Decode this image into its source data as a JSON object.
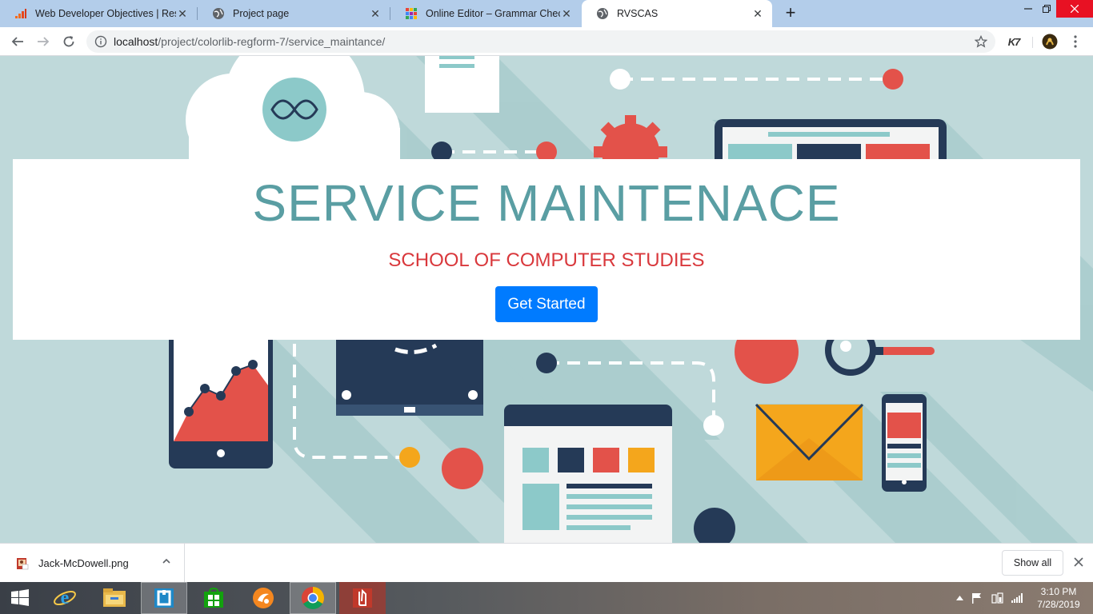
{
  "browser": {
    "tabs": [
      {
        "title": "Web Developer Objectives | Resu",
        "icon": "chart-bars-icon",
        "active": false
      },
      {
        "title": "Project page",
        "icon": "globe-icon",
        "active": false
      },
      {
        "title": "Online Editor – Grammar Checke",
        "icon": "grid-color-icon",
        "active": false
      },
      {
        "title": "RVSCAS",
        "icon": "globe-icon",
        "active": true
      }
    ],
    "url_host": "localhost",
    "url_path": "/project/colorlib-regform-7/service_maintance/",
    "extension_label": "K7"
  },
  "page": {
    "hero_title": "SERVICE MAINTENACE",
    "hero_subtitle": "SCHOOL OF COMPUTER STUDIES",
    "cta_label": "Get Started",
    "colors": {
      "title": "#5a9ea3",
      "subtitle": "#d9383c",
      "button": "#007bff",
      "background": "#bfd9da"
    }
  },
  "downloads": {
    "file_name": "Jack-McDowell.png",
    "show_all_label": "Show all"
  },
  "taskbar": {
    "apps": [
      "windows-start-icon",
      "internet-explorer-icon",
      "file-explorer-icon",
      "store-app-icon",
      "microsoft-store-icon",
      "uc-browser-icon",
      "chrome-icon",
      "acrobat-icon"
    ],
    "time": "3:10 PM",
    "date": "7/28/2019"
  }
}
